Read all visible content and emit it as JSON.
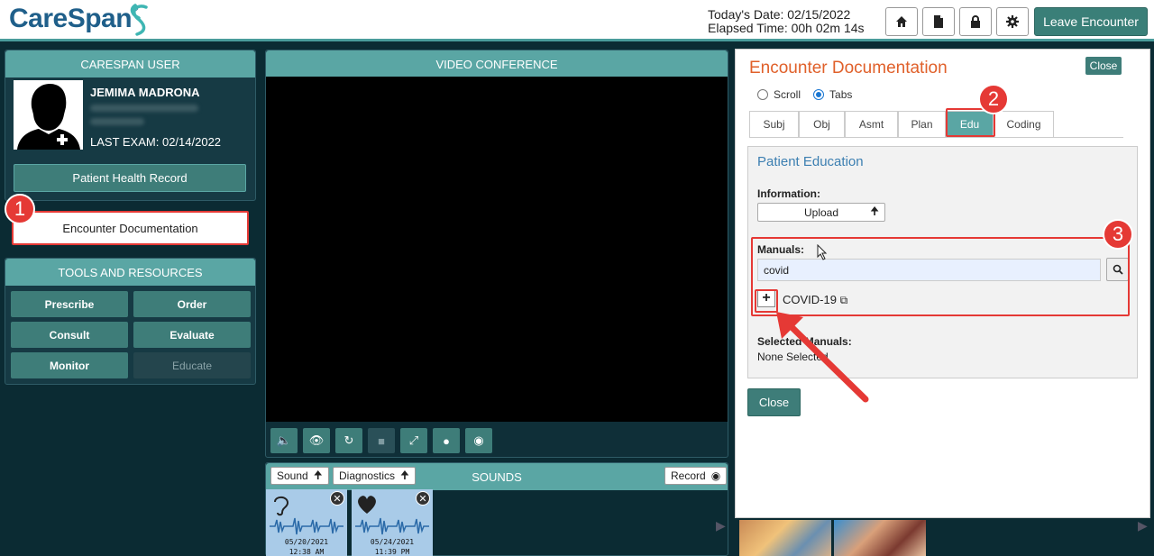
{
  "header": {
    "brand": "CareSpan",
    "trademark": "®",
    "date_label": "Today's Date: 02/15/2022",
    "elapsed_label": "Elapsed Time: 00h 02m 14s",
    "leave_label": "Leave Encounter"
  },
  "user_panel": {
    "title": "CARESPAN USER",
    "name": "JEMIMA MADRONA",
    "last_exam_label": "LAST EXAM:",
    "last_exam_date": "02/14/2022",
    "phr_label": "Patient Health Record",
    "encounter_doc_label": "Encounter Documentation"
  },
  "tools": {
    "title": "TOOLS AND RESOURCES",
    "items": [
      "Prescribe",
      "Order",
      "Consult",
      "Evaluate",
      "Monitor",
      "Educate"
    ]
  },
  "video": {
    "title": "VIDEO CONFERENCE"
  },
  "sounds": {
    "title": "SOUNDS",
    "sound_label": "Sound",
    "diag_label": "Diagnostics",
    "record_label": "Record",
    "cards": [
      {
        "icon": "ear-icon",
        "date": "05/20/2021",
        "time": "12:38 AM"
      },
      {
        "icon": "heart-icon",
        "date": "05/24/2021",
        "time": "11:39 PM"
      }
    ]
  },
  "doc": {
    "title": "Encounter Documentation",
    "close_label": "Close",
    "scroll_label": "Scroll",
    "tabs_label": "Tabs",
    "tabs": [
      "Subj",
      "Obj",
      "Asmt",
      "Plan",
      "Edu",
      "Coding"
    ],
    "active_tab": "Edu",
    "section_title": "Patient Education",
    "info_label": "Information:",
    "upload_label": "Upload",
    "manuals_label": "Manuals:",
    "search_value": "covid",
    "result_label": "COVID-19",
    "selected_label": "Selected Manuals:",
    "none_label": "None Selected",
    "bottom_close": "Close"
  },
  "badges": [
    "1",
    "2",
    "3"
  ],
  "colors": {
    "teal": "#5aa6a4",
    "dark_teal": "#3e7d79",
    "navy": "#0b2b33",
    "annotation_red": "#e53935",
    "title_orange": "#e0602a"
  }
}
